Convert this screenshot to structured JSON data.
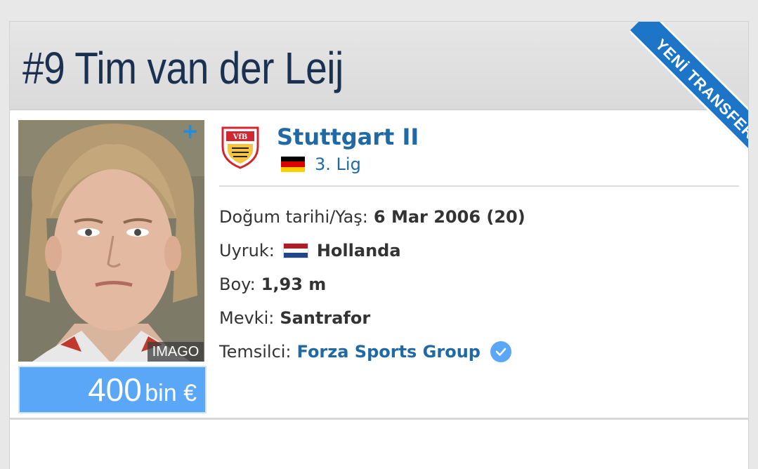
{
  "player": {
    "number": "#9",
    "first_name": "Tim",
    "last_name": "van der Leij"
  },
  "ribbon": {
    "label": "YENİ TRANSFER",
    "color": "#1d75c8"
  },
  "photo": {
    "credit": "IMAGO",
    "add_icon": "plus-icon"
  },
  "market_value": {
    "amount": "400",
    "unit": "bin €",
    "color": "#5aa6f7"
  },
  "club": {
    "name": "Stuttgart II",
    "league": "3. Lig",
    "league_flag": "germany-flag",
    "logo": "vfb-stuttgart-crest"
  },
  "details": {
    "birth_label": "Doğum tarihi/Yaş:",
    "birth_value": "6 Mar 2006 (20)",
    "nationality_label": "Uyruk:",
    "nationality_value": "Hollanda",
    "nationality_flag": "netherlands-flag",
    "height_label": "Boy:",
    "height_value": "1,93 m",
    "position_label": "Mevki:",
    "position_value": "Santrafor",
    "agent_label": "Temsilci:",
    "agent_value": "Forza Sports Group",
    "agent_badge": "verified-check-icon"
  },
  "colors": {
    "title": "#1a3151",
    "link": "#1f6aa5",
    "accent_blue": "#1d75c8"
  }
}
